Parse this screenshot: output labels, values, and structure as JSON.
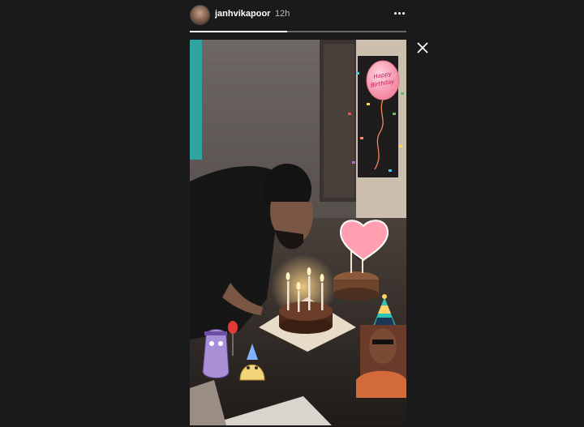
{
  "header": {
    "username": "janhvikapoor",
    "timestamp": "12h",
    "progress": 0.45
  },
  "media": {
    "sticker_text": "Happy Birthday"
  },
  "icons": {
    "more": "more-options-icon",
    "close": "close-icon"
  },
  "colors": {
    "background": "#1a1a1a",
    "text_primary": "#ffffff",
    "text_secondary": "#bdbdbd"
  }
}
